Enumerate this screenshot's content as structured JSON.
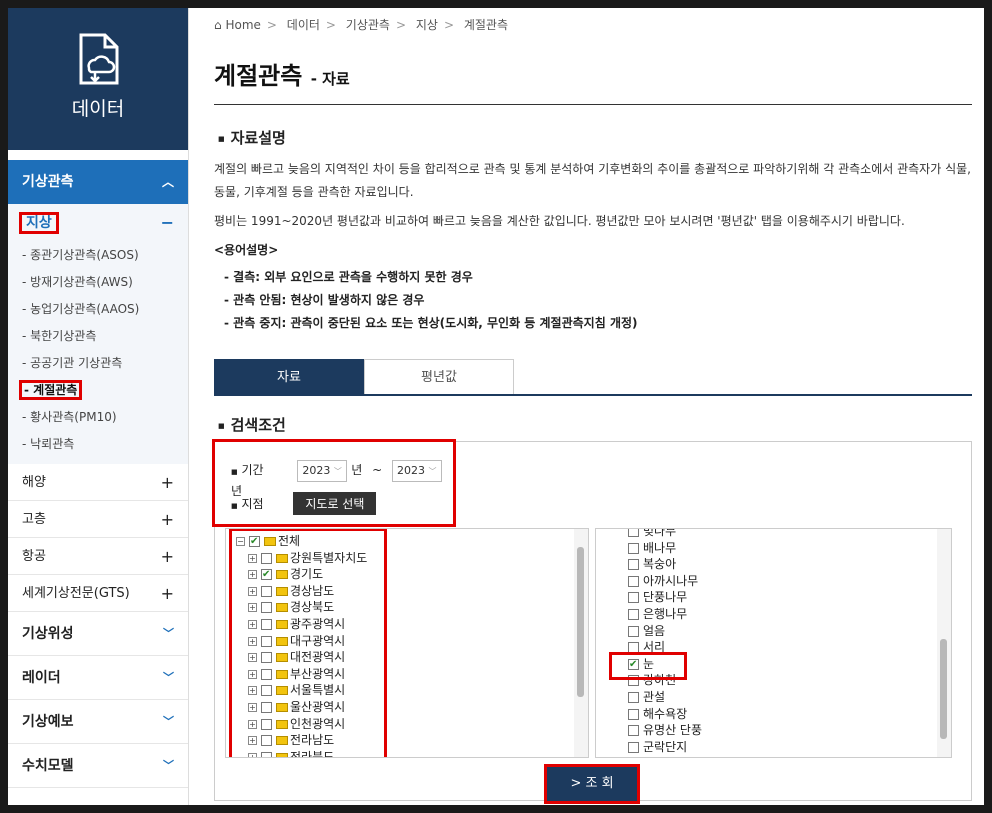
{
  "sidebar": {
    "hero_title": "데이터",
    "category": "기상관측",
    "sub": "지상",
    "links": [
      "- 종관기상관측(ASOS)",
      "- 방재기상관측(AWS)",
      "- 농업기상관측(AAOS)",
      "- 북한기상관측",
      "- 공공기관 기상관측",
      "- 계절관측",
      "- 황사관측(PM10)",
      "- 낙뢰관측"
    ],
    "rows": [
      "해양",
      "고층",
      "항공",
      "세계기상전문(GTS)"
    ],
    "big": [
      "기상위성",
      "레이더",
      "기상예보",
      "수치모델"
    ]
  },
  "crumb": [
    "Home",
    "데이터",
    "기상관측",
    "지상",
    "계절관측"
  ],
  "title": "계절관측",
  "subtitle": "- 자료",
  "desc": {
    "heading": "자료설명",
    "p1": "계절의 빠르고 늦음의 지역적인 차이 등을 합리적으로 관측 및 통계 분석하여 기후변화의 추이를 총괄적으로 파악하기위해 각 관측소에서 관측자가 식물, 동물, 기후계절 등을 관측한 자료입니다.",
    "p2": "평비는 1991~2020년 평년값과 비교하여 빠르고 늦음을 계산한 값입니다. 평년값만 모아 보시려면 '평년값' 탭을 이용해주시기 바랍니다.",
    "terms_title": "<용어설명>",
    "terms": [
      "- 결측: 외부 요인으로 관측을 수행하지 못한 경우",
      "- 관측 안됨: 현상이 발생하지 않은 경우",
      "- 관측 중지: 관측이 중단된 요소 또는 현상(도시화, 무인화 등 계절관측지침 개정)"
    ]
  },
  "tabs": [
    "자료",
    "평년값"
  ],
  "search": {
    "heading": "검색조건",
    "period_label": "기간",
    "year_from": "2023",
    "year_to": "2023",
    "year_unit": "년",
    "tilde": "~",
    "station_label": "지점",
    "map_button": "지도로 선택",
    "tree": [
      "전체",
      "강원특별자치도",
      "경기도",
      "경상남도",
      "경상북도",
      "광주광역시",
      "대구광역시",
      "대전광역시",
      "부산광역시",
      "서울특별시",
      "울산광역시",
      "인천광역시",
      "전라남도",
      "전라북도"
    ],
    "tree_checked": [
      0,
      2
    ],
    "items": [
      "벚나무",
      "배나무",
      "복숭아",
      "아까시나무",
      "단풍나무",
      "은행나무",
      "얼음",
      "서리",
      "눈",
      "강하천",
      "관설",
      "해수욕장",
      "유명산 단풍",
      "군락단지"
    ],
    "items_checked": [
      8
    ],
    "go_button": "> 조 회"
  }
}
